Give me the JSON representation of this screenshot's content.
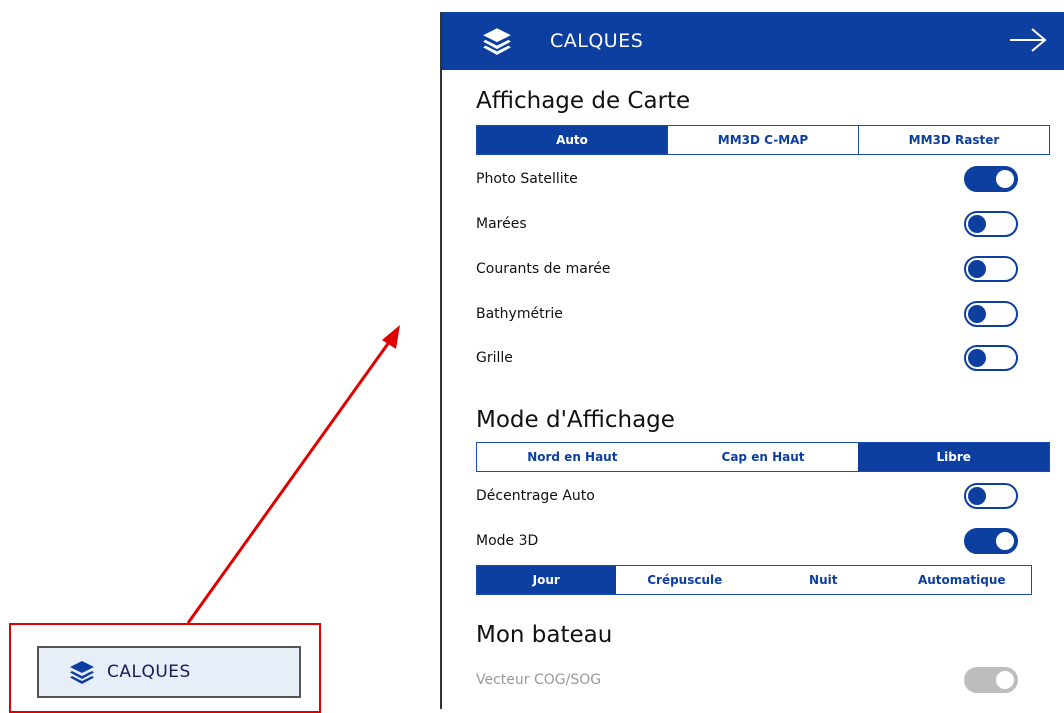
{
  "callout": {
    "button_label": "CALQUES",
    "icon": "layers-icon",
    "highlight_color": "#e00000"
  },
  "panel": {
    "header": {
      "title": "CALQUES",
      "icon": "layers-icon",
      "close_icon": "arrow-right-icon",
      "background": "#0d3fa0"
    },
    "map_display": {
      "title": "Affichage de Carte",
      "options": [
        "Auto",
        "MM3D C-MAP",
        "MM3D Raster"
      ],
      "selected": "Auto",
      "toggles": [
        {
          "label": "Photo Satellite",
          "state": "on"
        },
        {
          "label": "Marées",
          "state": "off"
        },
        {
          "label": "Courants de marée",
          "state": "off"
        },
        {
          "label": "Bathymétrie",
          "state": "off"
        },
        {
          "label": "Grille",
          "state": "off"
        }
      ]
    },
    "display_mode": {
      "title": "Mode d'Affichage",
      "options": [
        "Nord en Haut",
        "Cap en Haut",
        "Libre"
      ],
      "selected": "Libre",
      "toggles": [
        {
          "label": "Décentrage Auto",
          "state": "off"
        },
        {
          "label": "Mode 3D",
          "state": "on"
        }
      ],
      "light_options": [
        "Jour",
        "Crépuscule",
        "Nuit",
        "Automatique"
      ],
      "light_selected": "Jour"
    },
    "my_boat": {
      "title": "Mon bateau",
      "toggles": [
        {
          "label": "Vecteur COG/SOG",
          "state": "disabled"
        }
      ]
    }
  }
}
